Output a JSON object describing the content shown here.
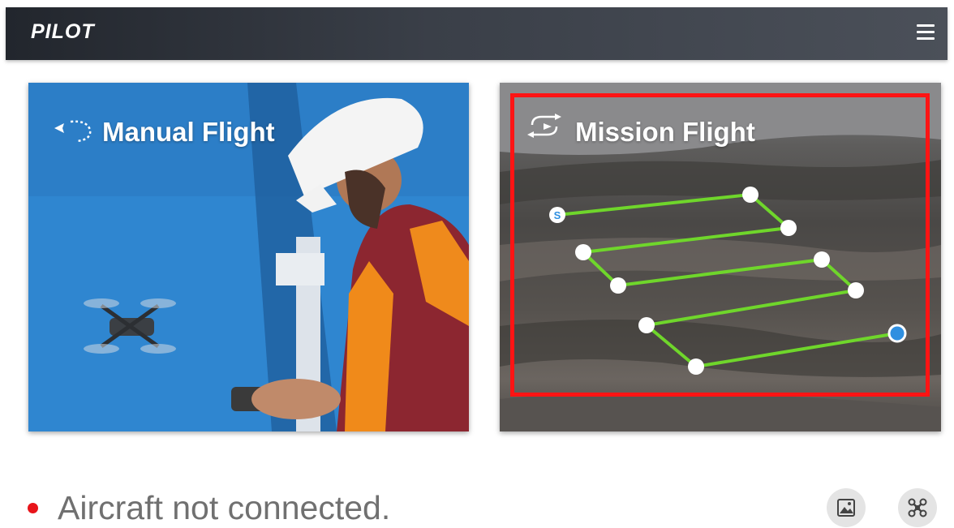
{
  "header": {
    "brand": "PILOT",
    "menu_icon": "hamburger-menu-icon"
  },
  "cards": {
    "manual": {
      "title": "Manual Flight",
      "icon": "manual-flight-icon"
    },
    "mission": {
      "title": "Mission Flight",
      "icon": "mission-flight-icon",
      "start_marker": "S"
    }
  },
  "status": {
    "text": "Aircraft not connected.",
    "color": "#e8141a"
  },
  "actions": {
    "gallery_icon": "gallery-icon",
    "drone_settings_icon": "drone-settings-icon"
  },
  "colors": {
    "header_bg": "#2e333a",
    "highlight": "#ff1414",
    "path_line": "#6fd62b",
    "end_point": "#2f8fe0"
  }
}
